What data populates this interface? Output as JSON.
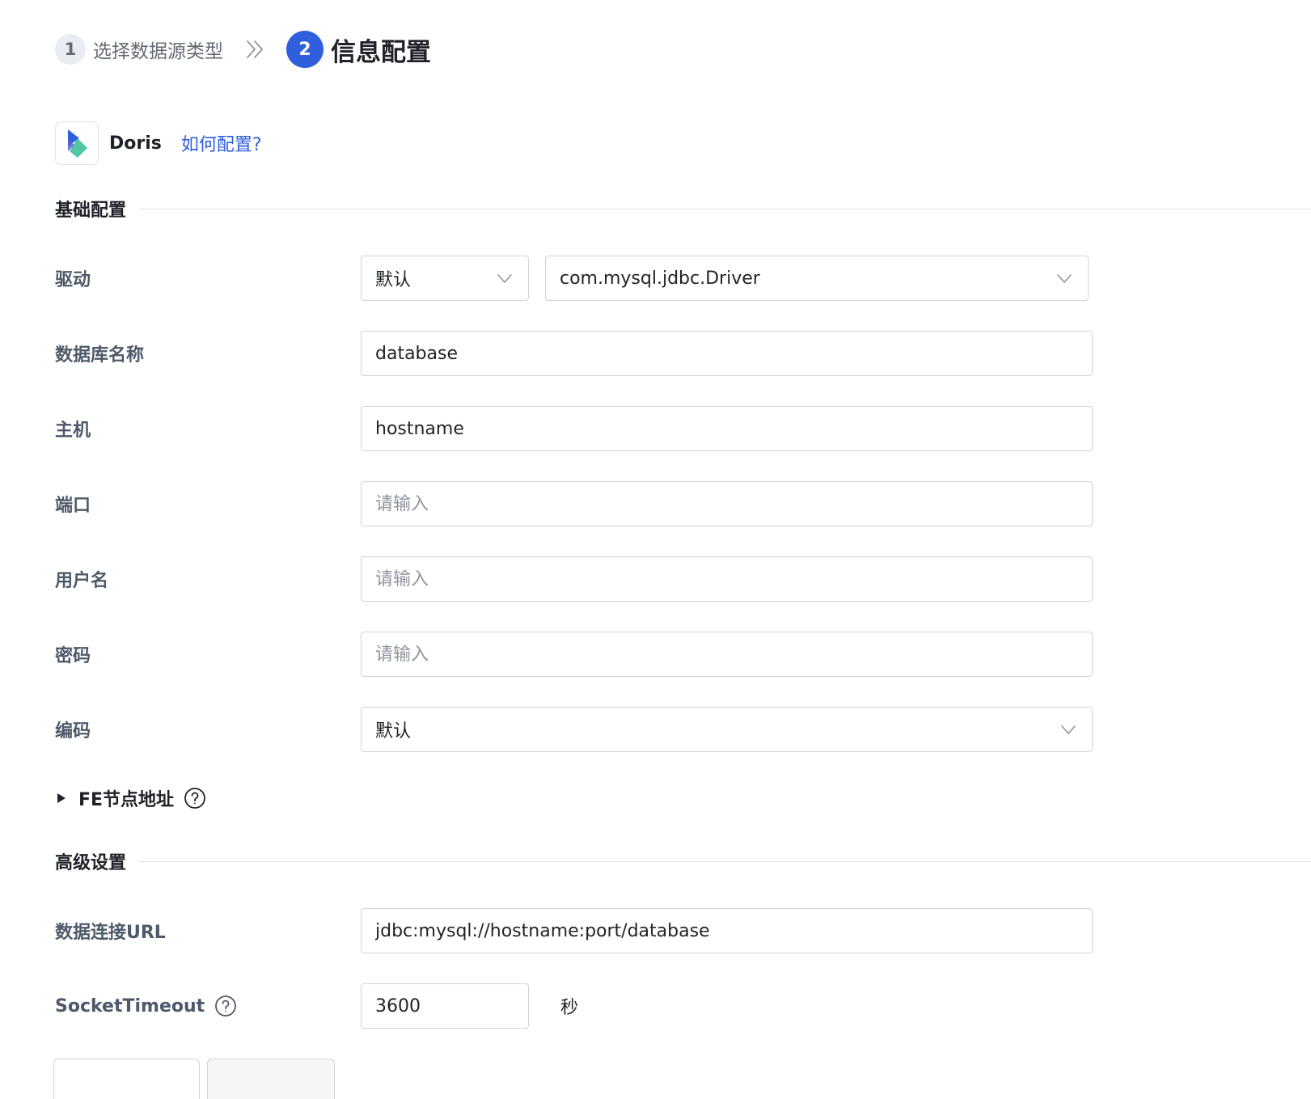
{
  "stepper": {
    "step1_number": "1",
    "step1_label": "选择数据源类型",
    "step2_number": "2",
    "step2_label": "信息配置"
  },
  "source": {
    "name": "Doris",
    "help_link": "如何配置?"
  },
  "sections": {
    "basic_title": "基础配置",
    "advanced_title": "高级设置"
  },
  "form": {
    "driver": {
      "label": "驱动",
      "type_value": "默认",
      "class_value": "com.mysql.jdbc.Driver"
    },
    "database": {
      "label": "数据库名称",
      "value": "database"
    },
    "host": {
      "label": "主机",
      "value": "hostname"
    },
    "port": {
      "label": "端口",
      "placeholder": "请输入"
    },
    "username": {
      "label": "用户名",
      "placeholder": "请输入"
    },
    "password": {
      "label": "密码",
      "placeholder": "请输入"
    },
    "encoding": {
      "label": "编码",
      "value": "默认"
    },
    "fe_nodes": {
      "label": "FE节点地址"
    },
    "jdbc_url": {
      "label": "数据连接URL",
      "value": "jdbc:mysql://hostname:port/database"
    },
    "socket_timeout": {
      "label": "SocketTimeout",
      "value": "3600",
      "unit": "秒"
    }
  },
  "colors": {
    "primary": "#2f5fdc",
    "border": "#d0d3d9",
    "label": "#4e5969",
    "text": "#1f2329"
  }
}
